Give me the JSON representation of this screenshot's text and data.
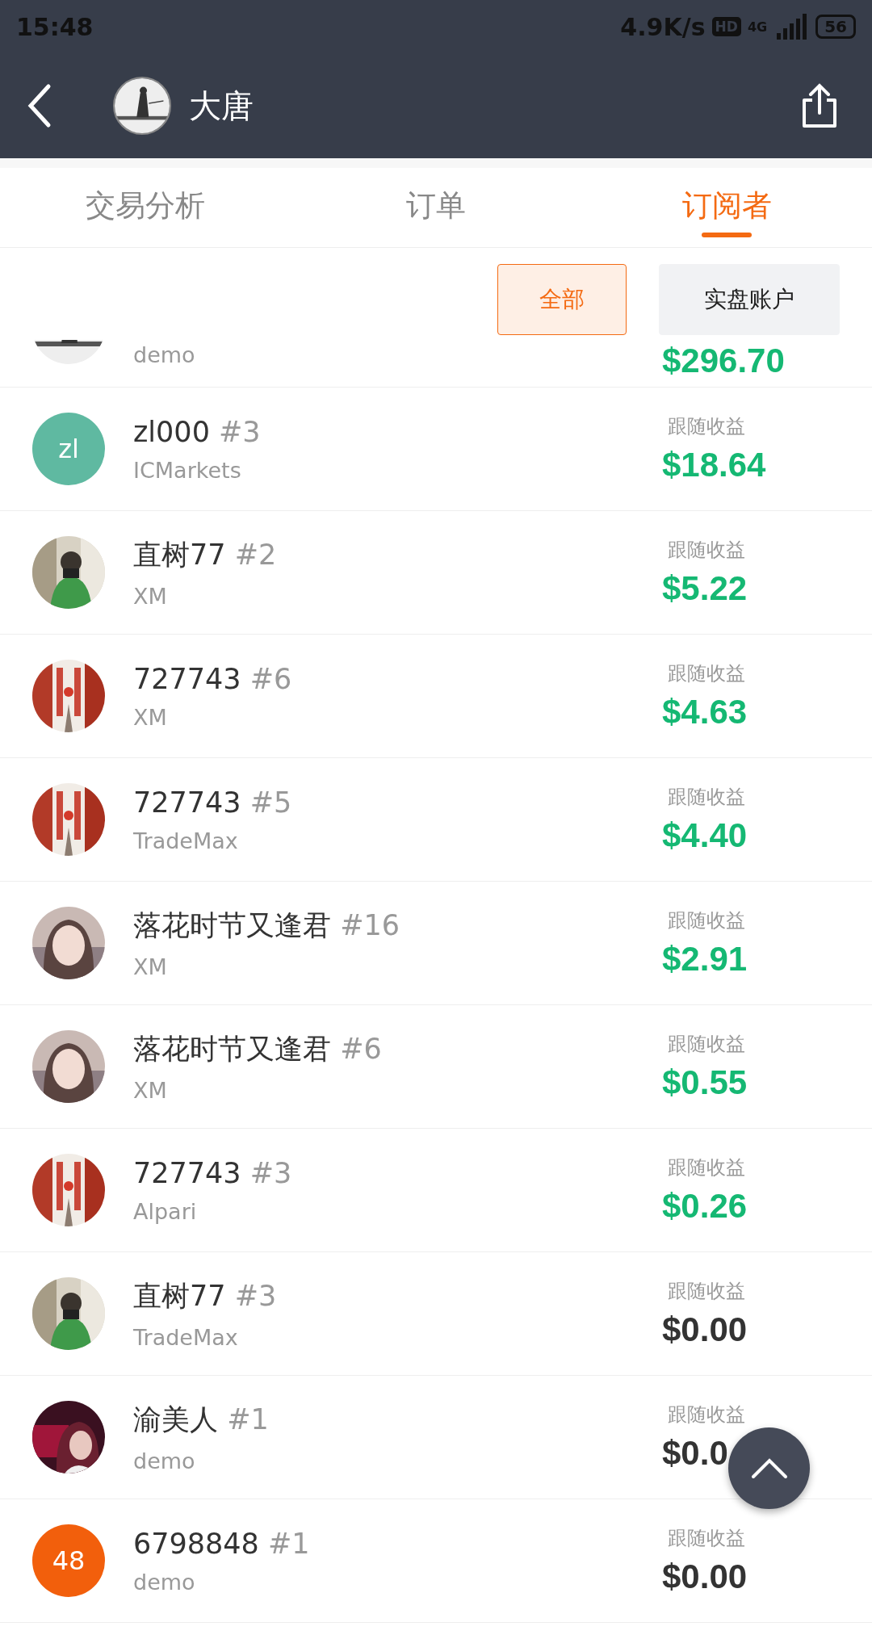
{
  "status_bar": {
    "time": "15:48",
    "speed": "4.9K/s",
    "hd": "HD",
    "network": "4G",
    "battery": "56"
  },
  "header": {
    "title": "大唐"
  },
  "tabs": [
    {
      "label": "交易分析",
      "selected": false
    },
    {
      "label": "订单",
      "selected": false
    },
    {
      "label": "订阅者",
      "selected": true
    }
  ],
  "filters": [
    {
      "label": "全部",
      "selected": true
    },
    {
      "label": "实盘账户",
      "selected": false
    }
  ],
  "partial_row": {
    "broker": "demo",
    "amount": "$296.70",
    "positive": true
  },
  "subscribers": [
    {
      "avatar": {
        "kind": "initials",
        "text": "zl",
        "color": "#5fb9a1"
      },
      "name": "zl000",
      "number": "#3",
      "broker": "ICMarkets",
      "label": "跟随收益",
      "amount": "$18.64",
      "positive": true
    },
    {
      "name": "直树77",
      "number": "#2",
      "broker": "XM",
      "label": "跟随收益",
      "amount": "$5.22",
      "positive": true
    },
    {
      "name": "727743",
      "number": "#6",
      "broker": "XM",
      "label": "跟随收益",
      "amount": "$4.63",
      "positive": true
    },
    {
      "name": "727743",
      "number": "#5",
      "broker": "TradeMax",
      "label": "跟随收益",
      "amount": "$4.40",
      "positive": true
    },
    {
      "name": "落花时节又逢君",
      "number": "#16",
      "broker": "XM",
      "label": "跟随收益",
      "amount": "$2.91",
      "positive": true
    },
    {
      "name": "落花时节又逢君",
      "number": "#6",
      "broker": "XM",
      "label": "跟随收益",
      "amount": "$0.55",
      "positive": true
    },
    {
      "name": "727743",
      "number": "#3",
      "broker": "Alpari",
      "label": "跟随收益",
      "amount": "$0.26",
      "positive": true
    },
    {
      "name": "直树77",
      "number": "#3",
      "broker": "TradeMax",
      "label": "跟随收益",
      "amount": "$0.00",
      "positive": false
    },
    {
      "name": "渝美人",
      "number": "#1",
      "broker": "demo",
      "label": "跟随收益",
      "amount": "$0.0",
      "positive": false
    },
    {
      "avatar": {
        "kind": "initials",
        "text": "48",
        "color": "#f25f0c"
      },
      "name": "6798848",
      "number": "#1",
      "broker": "demo",
      "label": "跟随收益",
      "amount": "$0.00",
      "positive": false
    }
  ]
}
